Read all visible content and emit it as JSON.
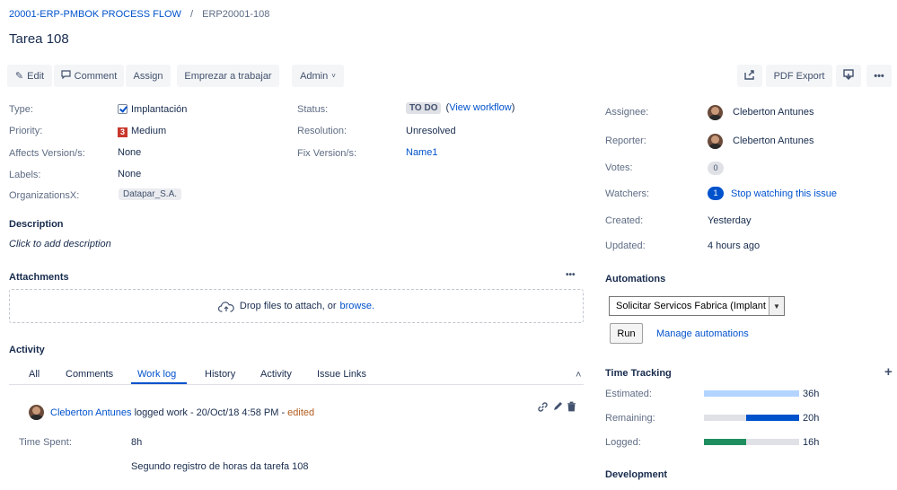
{
  "breadcrumb": {
    "project": "20001-ERP-PMBOK PROCESS FLOW",
    "separator": "/",
    "issue_key": "ERP20001-108"
  },
  "issue": {
    "title": "Tarea 108"
  },
  "toolbar": {
    "edit": "Edit",
    "comment": "Comment",
    "assign": "Assign",
    "start": "Emprezar a trabajar",
    "admin": "Admin",
    "pdf_export": "PDF Export",
    "more": "•••"
  },
  "details": {
    "type_label": "Type:",
    "type_value": "Implantación",
    "priority_label": "Priority:",
    "priority_value": "Medium",
    "priority_number": "3",
    "affects_label": "Affects Version/s:",
    "affects_value": "None",
    "labels_label": "Labels:",
    "labels_value": "None",
    "org_label": "OrganizationsX:",
    "org_value": "Datapar_S.A.",
    "status_label": "Status:",
    "status_value": "TO DO",
    "view_workflow": "View workflow",
    "resolution_label": "Resolution:",
    "resolution_value": "Unresolved",
    "fix_label": "Fix Version/s:",
    "fix_value": "Name1"
  },
  "description": {
    "title": "Description",
    "placeholder": "Click to add description"
  },
  "attachments": {
    "title": "Attachments",
    "more": "•••",
    "drop_text": "Drop files to attach, or",
    "browse": "browse."
  },
  "activity": {
    "title": "Activity",
    "tabs": [
      "All",
      "Comments",
      "Work log",
      "History",
      "Activity",
      "Issue Links"
    ],
    "collapse": "˄",
    "entry": {
      "author": "Cleberton Antunes",
      "action": "logged work - 20/Oct/18 4:58 PM -",
      "edited": "edited",
      "time_spent_label": "Time Spent:",
      "time_spent_value": "8h",
      "comment": "Segundo registro de horas da tarefa 108"
    }
  },
  "people": {
    "assignee_label": "Assignee:",
    "assignee": "Cleberton Antunes",
    "reporter_label": "Reporter:",
    "reporter": "Cleberton Antunes",
    "votes_label": "Votes:",
    "votes": "0",
    "watchers_label": "Watchers:",
    "watchers": "1",
    "stop_watching": "Stop watching this issue"
  },
  "dates": {
    "created_label": "Created:",
    "created": "Yesterday",
    "updated_label": "Updated:",
    "updated": "4 hours ago"
  },
  "automations": {
    "title": "Automations",
    "selected": "Solicitar Servicos Fabrica (Implant",
    "run": "Run",
    "manage": "Manage automations"
  },
  "time_tracking": {
    "title": "Time Tracking",
    "add": "+",
    "estimated_label": "Estimated:",
    "estimated": "36h",
    "estimated_fraction": 1.0,
    "remaining_label": "Remaining:",
    "remaining": "20h",
    "remaining_fraction": 0.556,
    "logged_label": "Logged:",
    "logged": "16h",
    "logged_fraction": 0.444,
    "estimated_color": "#b3d4ff",
    "remaining_color": "#0052cc",
    "logged_color": "#1f8f5f"
  },
  "development": {
    "title": "Development"
  }
}
